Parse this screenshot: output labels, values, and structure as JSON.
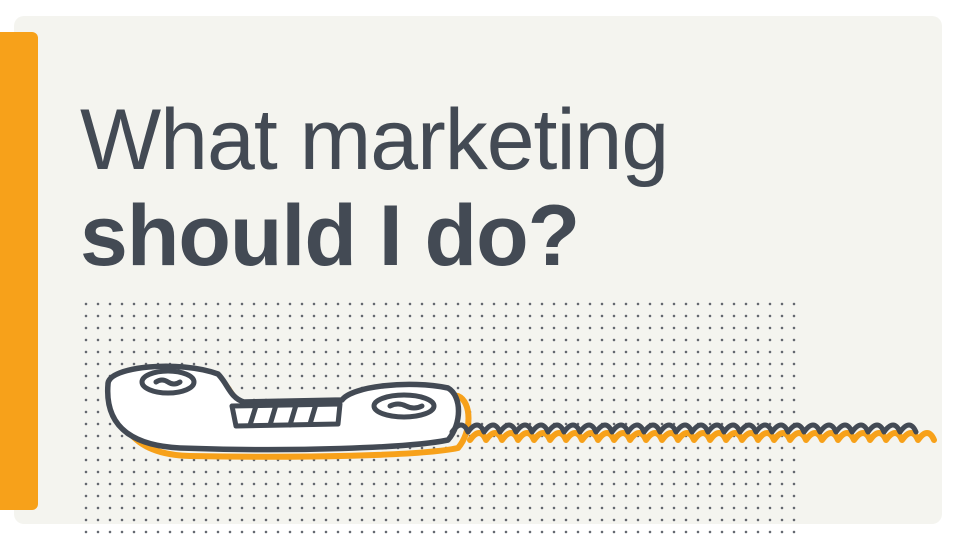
{
  "headline": {
    "line1": "What marketing",
    "line2": "should I do?"
  },
  "colors": {
    "background": "#f4f4ef",
    "accent": "#f7a11a",
    "ink": "#434a54"
  },
  "illustration": {
    "icon": "telephone-handset-icon",
    "description_visible": false
  }
}
